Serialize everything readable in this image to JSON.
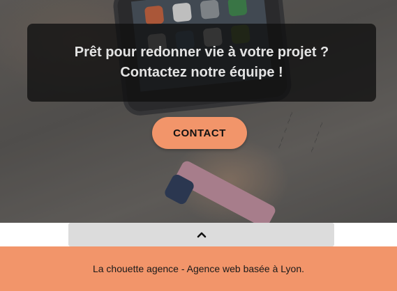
{
  "hero": {
    "headline_line1": "Prêt pour redonner vie à votre projet ?",
    "headline_line2": "Contactez notre équipe !"
  },
  "contact_button": {
    "label": "CONTACT"
  },
  "scroll_top": {
    "icon": "chevron-up-icon"
  },
  "footer": {
    "text": "La chouette agence - Agence web basée à Lyon."
  },
  "colors": {
    "accent": "#f2956a",
    "overlay_box": "#0f0f0f",
    "scroll_bar": "#dcdcdc"
  }
}
